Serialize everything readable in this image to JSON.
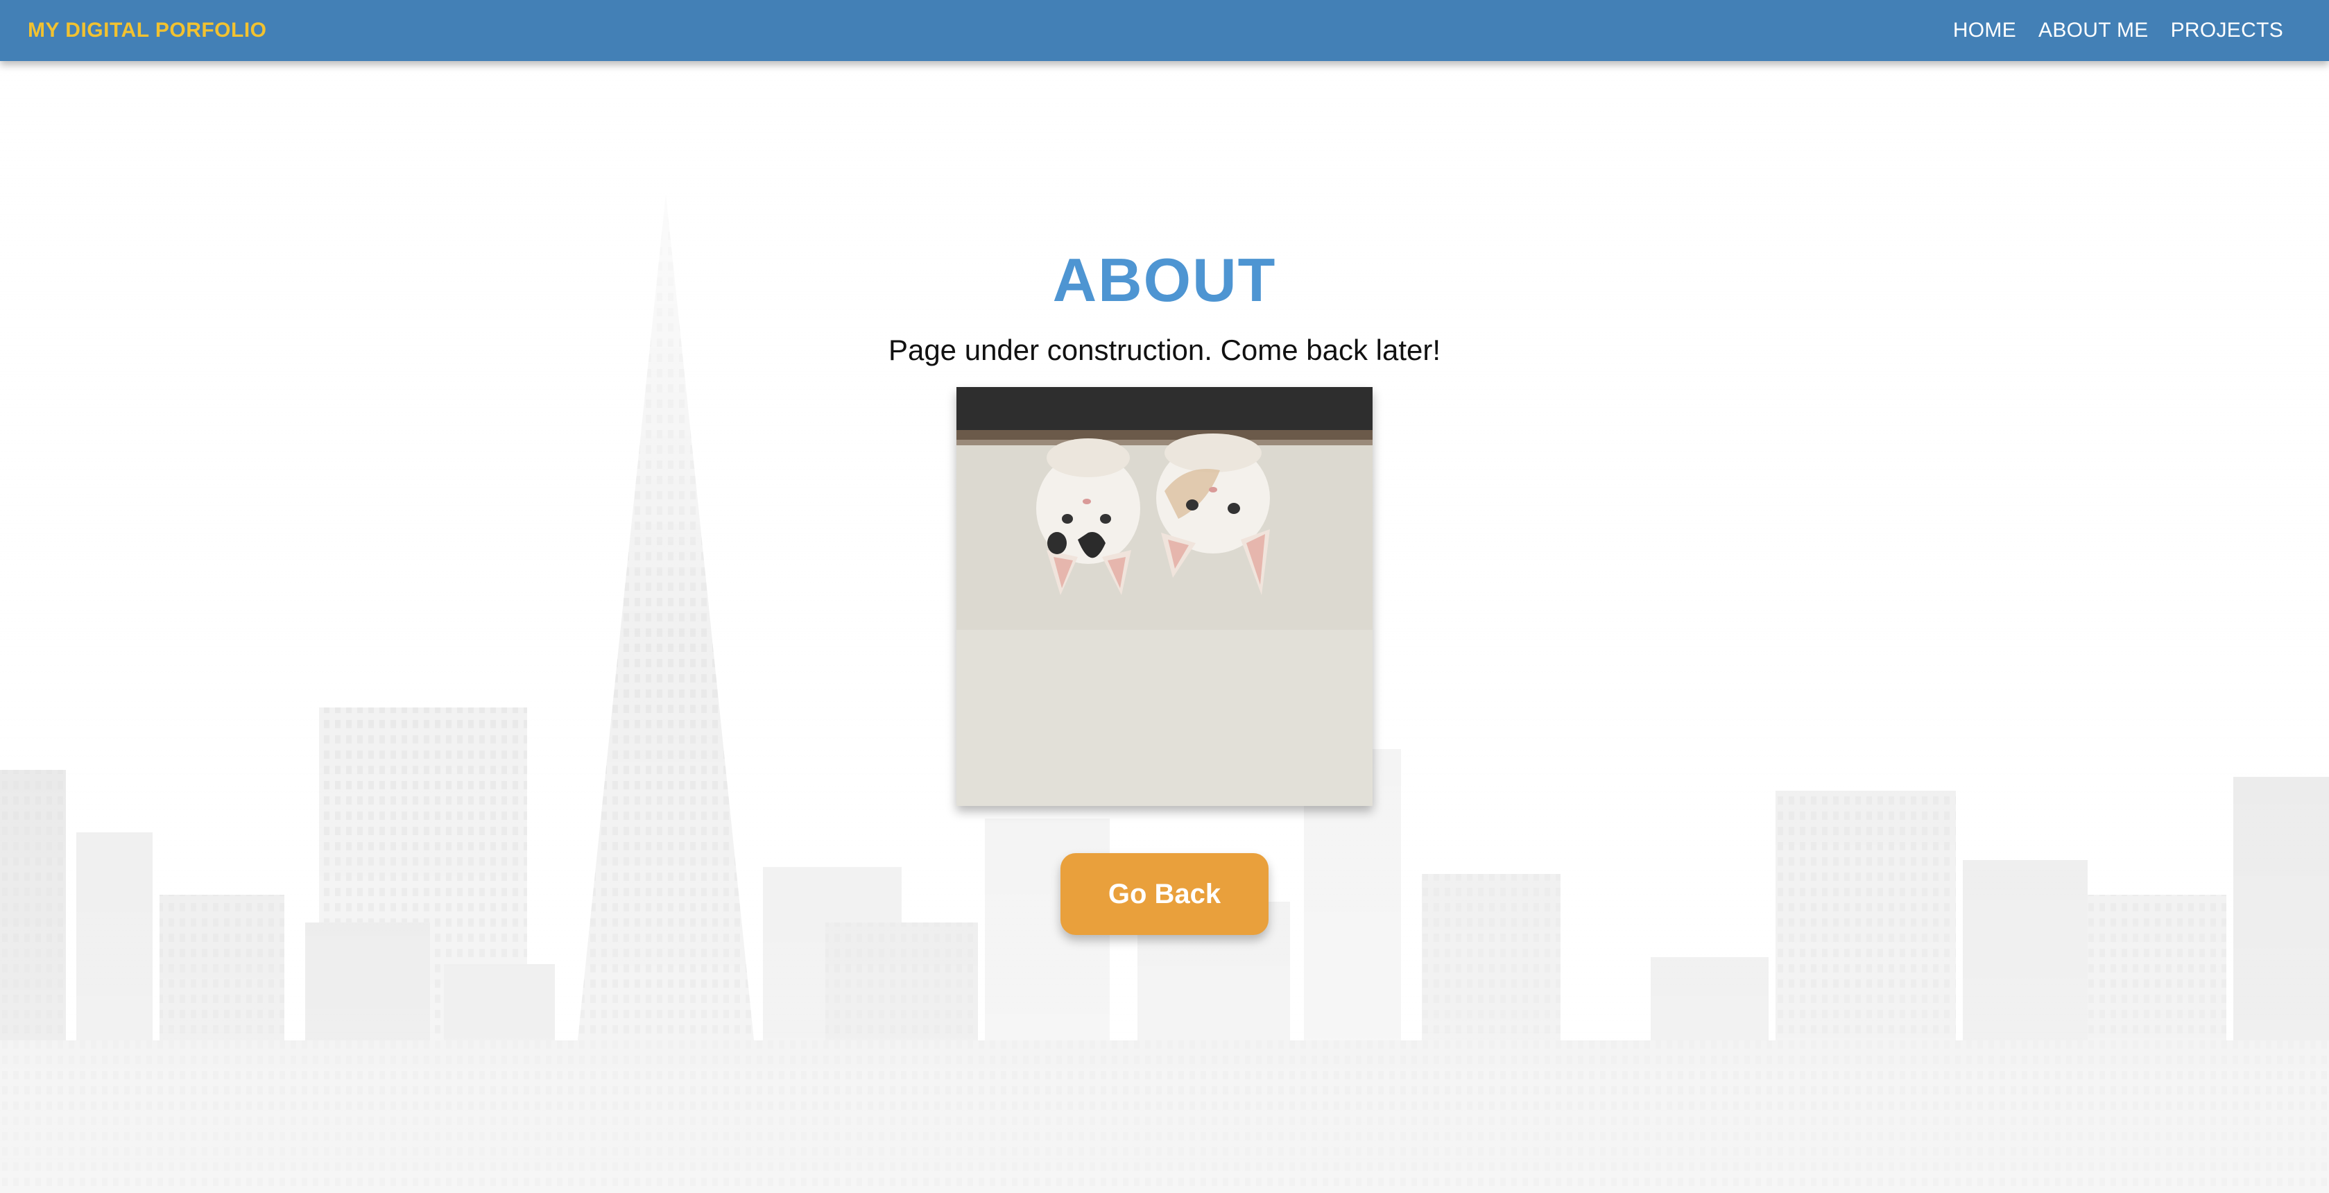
{
  "nav": {
    "brand": "MY DIGITAL PORFOLIO",
    "links": [
      "HOME",
      "ABOUT ME",
      "PROJECTS"
    ]
  },
  "main": {
    "title": "ABOUT",
    "subtitle": "Page under construction. Come back later!",
    "button_label": "Go Back"
  },
  "colors": {
    "navbar": "#4380b6",
    "brand": "#f2c230",
    "title": "#4e95d2",
    "button": "#e9a03c"
  }
}
